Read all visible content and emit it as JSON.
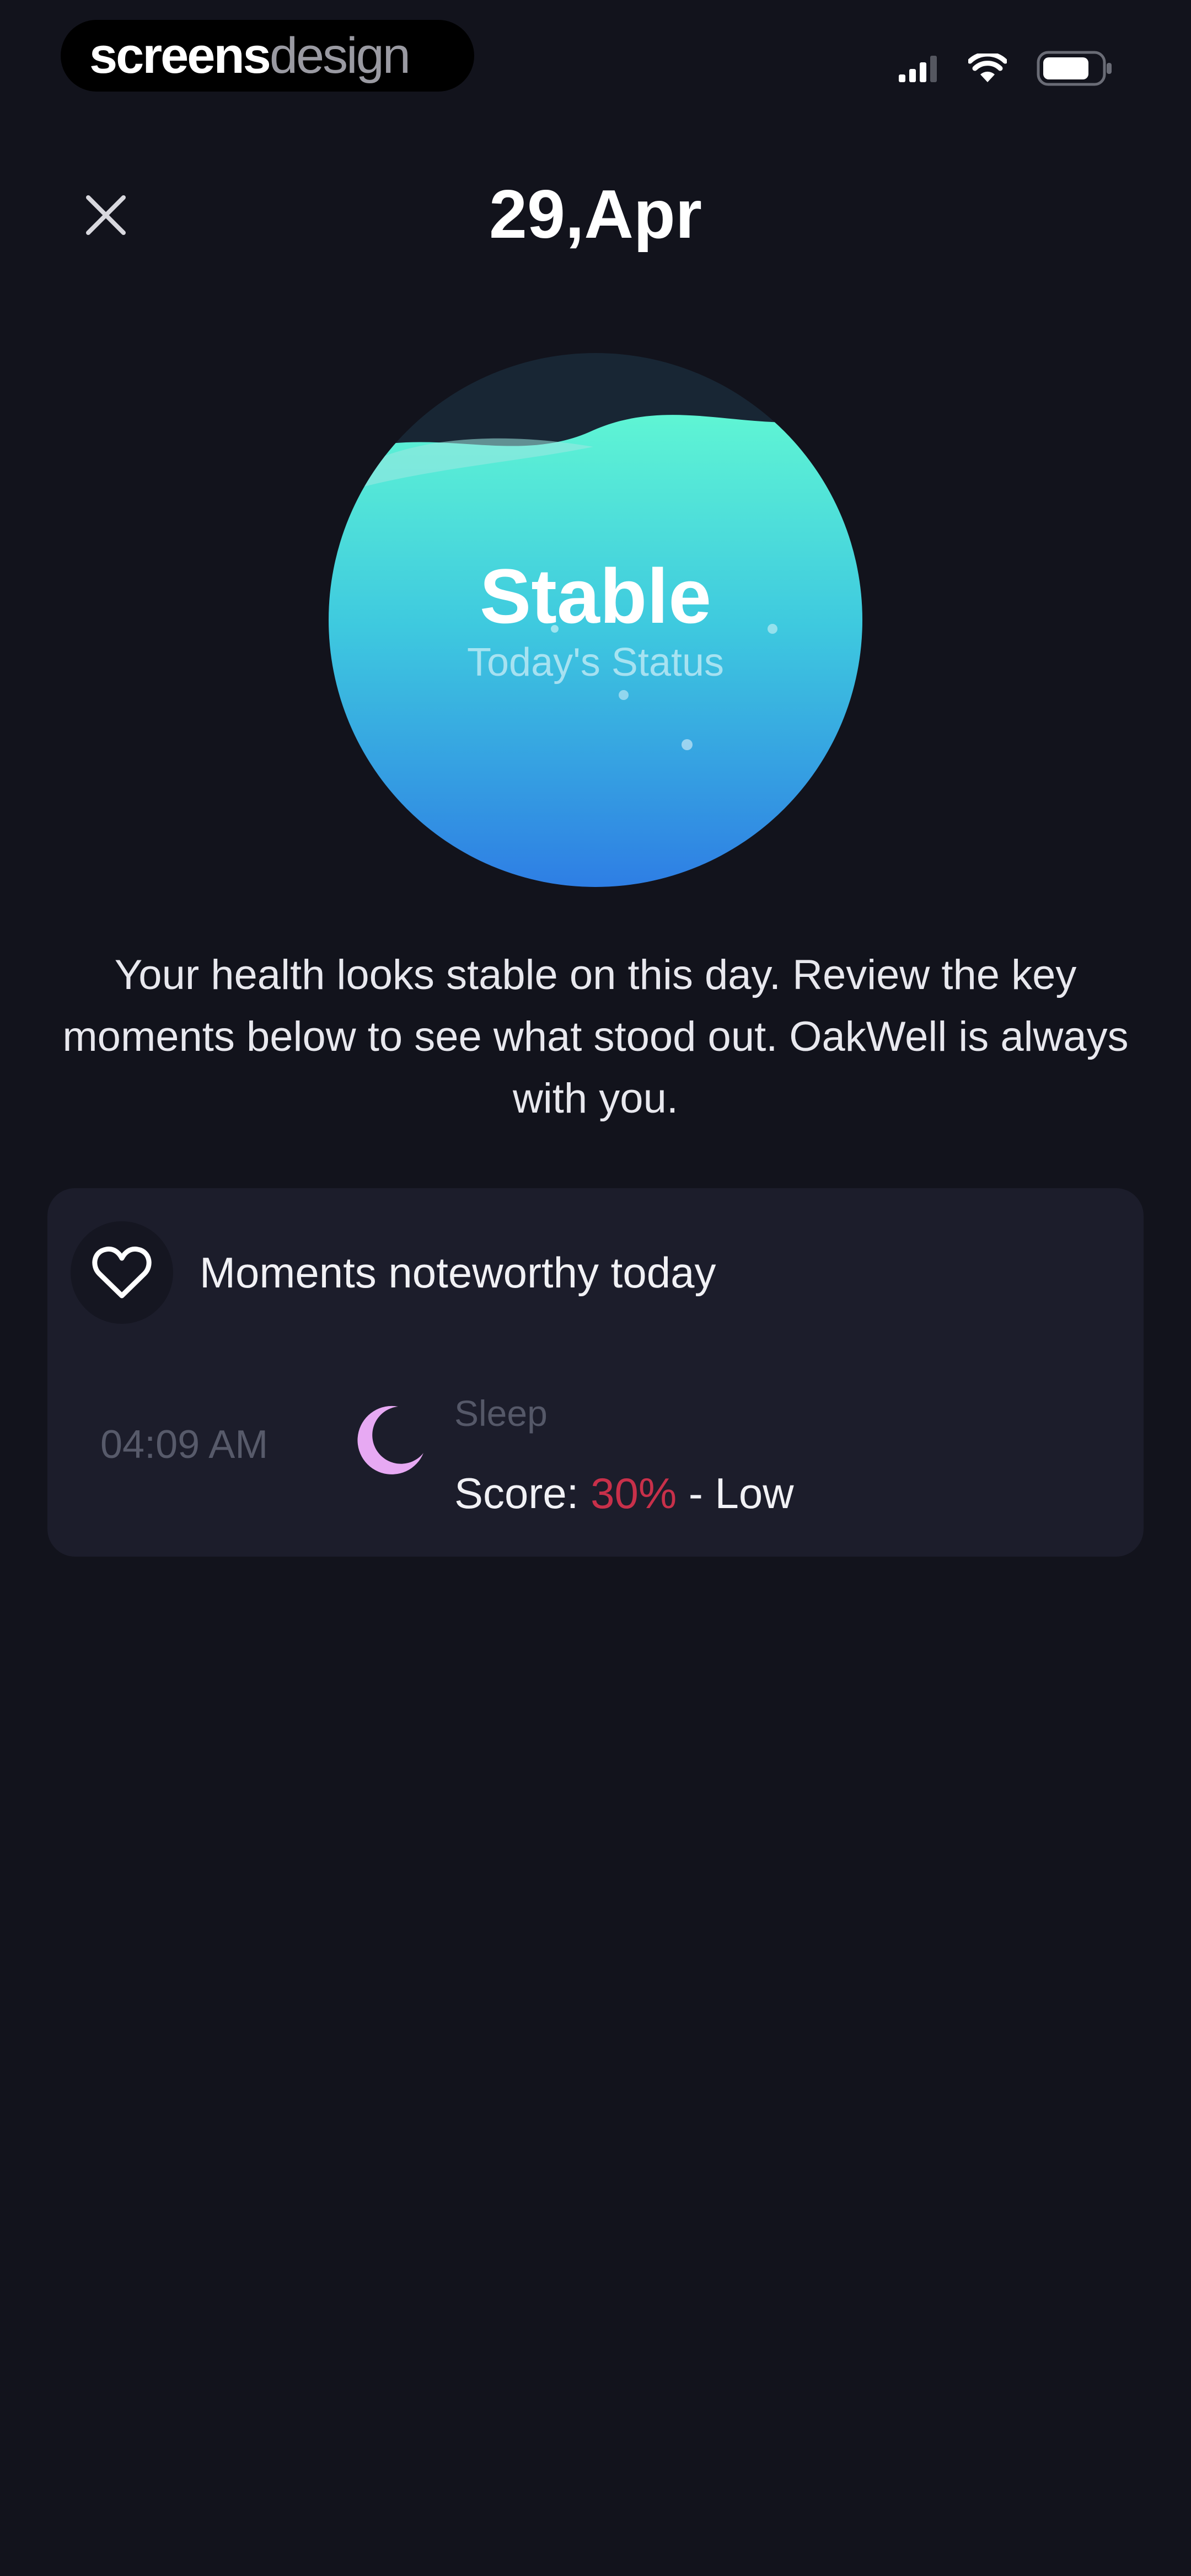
{
  "brand": {
    "part1": "screens",
    "part2": "design"
  },
  "header": {
    "title": "29,Apr",
    "close_icon": "close-icon"
  },
  "status_orb": {
    "status": "Stable",
    "subtitle": "Today's Status"
  },
  "description": "Your health looks stable on this day. Review the key moments below to see what stood out. OakWell is always with you.",
  "moments": {
    "title": "Moments noteworthy today",
    "header_icon": "heart-icon",
    "items": [
      {
        "time": "04:09 AM",
        "icon": "moon-icon",
        "label": "Sleep",
        "score_prefix": "Score:",
        "score_value": "30%",
        "score_suffix": "- Low"
      }
    ]
  },
  "colors": {
    "background": "#12131c",
    "card": "#1c1d2b",
    "accent_teal": "#5ff1d2",
    "accent_blue": "#2e7ee4",
    "score_low": "#c8304a",
    "moon": "#e7a9f3"
  }
}
